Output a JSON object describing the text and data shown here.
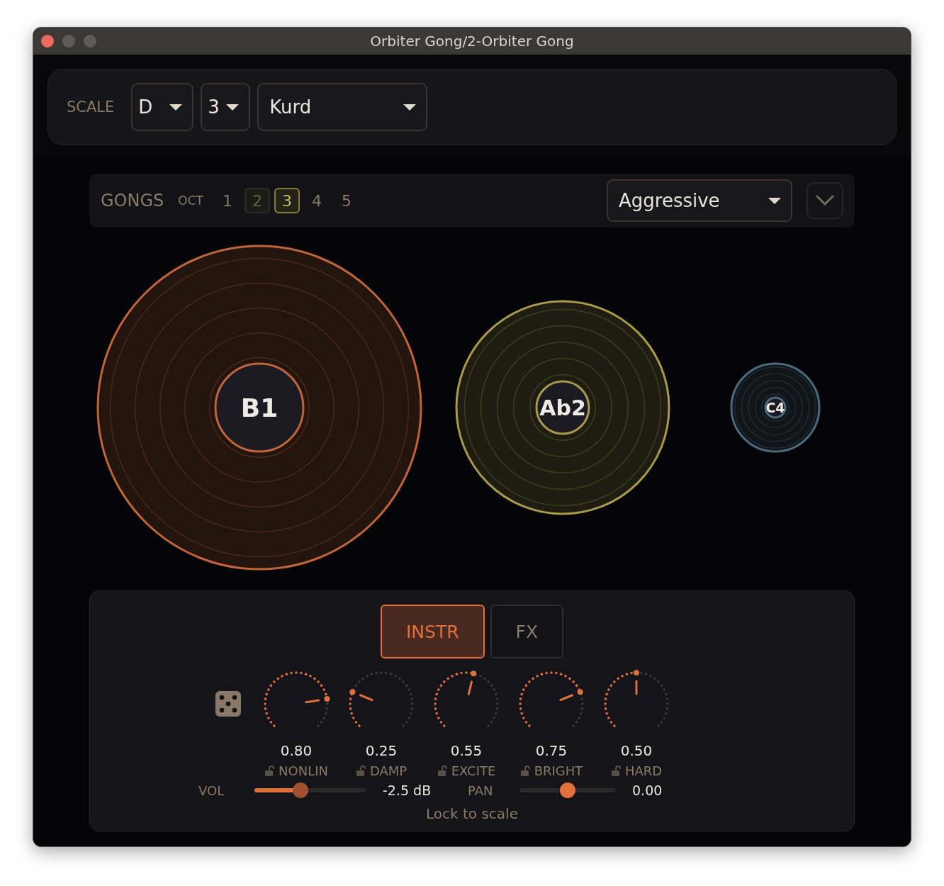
{
  "window": {
    "title": "Orbiter Gong/2-Orbiter Gong"
  },
  "scale": {
    "label": "SCALE",
    "root": "D",
    "octave": "3",
    "mode": "Kurd"
  },
  "gongs_bar": {
    "title": "GONGS",
    "oct_label": "OCT",
    "octaves": [
      {
        "label": "1",
        "selected": false,
        "highlighted": false
      },
      {
        "label": "2",
        "selected": false,
        "highlighted": true
      },
      {
        "label": "3",
        "selected": true,
        "highlighted": false
      },
      {
        "label": "4",
        "selected": false,
        "highlighted": false
      },
      {
        "label": "5",
        "selected": false,
        "highlighted": false
      }
    ],
    "preset": "Aggressive"
  },
  "gongs": [
    {
      "note": "B1",
      "color": "#c0653a"
    },
    {
      "note": "Ab2",
      "color": "#a89a4a"
    },
    {
      "note": "C4",
      "color": "#4a6a80"
    }
  ],
  "tabs": [
    {
      "label": "INSTR",
      "selected": true
    },
    {
      "label": "FX",
      "selected": false
    }
  ],
  "knobs": [
    {
      "value": "0.80",
      "label": "NONLIN",
      "level": 0.8
    },
    {
      "value": "0.25",
      "label": "DAMP",
      "level": 0.25
    },
    {
      "value": "0.55",
      "label": "EXCITE",
      "level": 0.55
    },
    {
      "value": "0.75",
      "label": "BRIGHT",
      "level": 0.75
    },
    {
      "value": "0.50",
      "label": "HARD",
      "level": 0.5
    }
  ],
  "volume": {
    "label": "VOL",
    "level": 0.41,
    "reading": "-2.5 dB"
  },
  "pan": {
    "label": "PAN",
    "level": 0.5,
    "reading": "0.00"
  },
  "lock_to_scale": "Lock to scale"
}
